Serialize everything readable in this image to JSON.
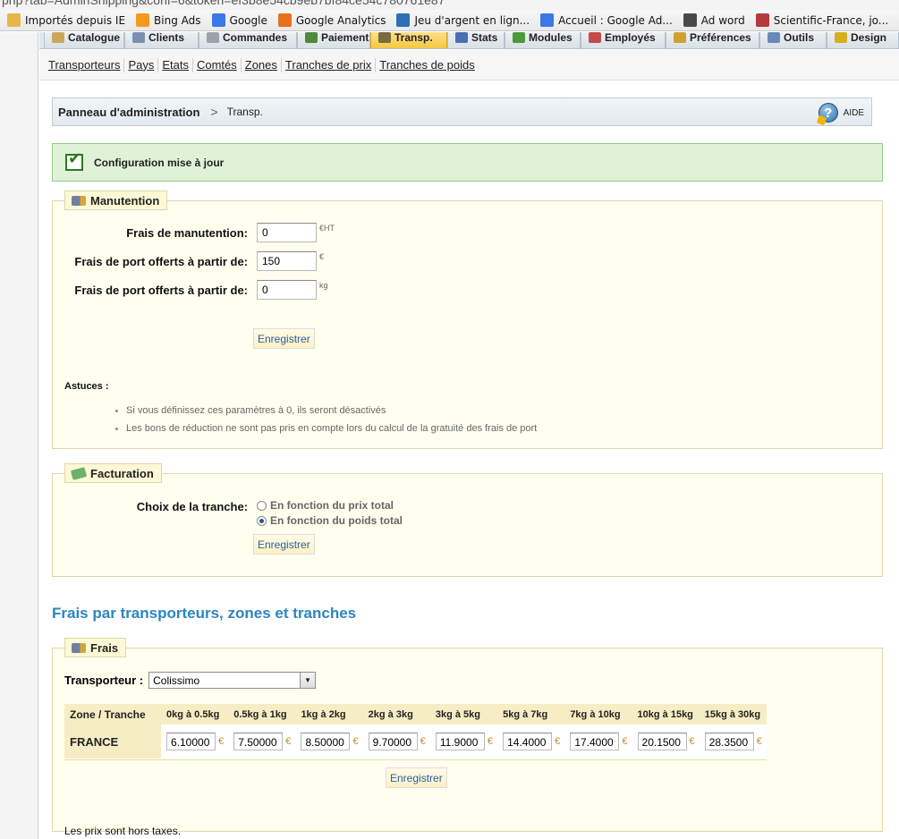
{
  "browser": {
    "url_fragment": "php?tab=AdminShipping&conf=6&token=ef3b8e54cb9eb7bf84ce54c780761e87",
    "bookmarks": [
      {
        "label": "Importés depuis IE",
        "icon": "folder-icon",
        "color": "#e8b54a"
      },
      {
        "label": "Bing Ads",
        "icon": "bing-icon",
        "color": "#f39a1e"
      },
      {
        "label": "Google",
        "icon": "google-icon",
        "color": "#3b78e7"
      },
      {
        "label": "Google Analytics",
        "icon": "analytics-icon",
        "color": "#e8711c"
      },
      {
        "label": "Jeu d'argent en lign...",
        "icon": "diamond-icon",
        "color": "#2c6fb5"
      },
      {
        "label": "Accueil : Google Ad...",
        "icon": "google-icon",
        "color": "#3b78e7"
      },
      {
        "label": "Ad word",
        "icon": "google-g-icon",
        "color": "#4a4a4a"
      },
      {
        "label": "Scientific-France, jo...",
        "icon": "gear-icon",
        "color": "#b33b3b"
      }
    ]
  },
  "main_tabs": [
    {
      "label": "Catalogue",
      "color": "#caa85a"
    },
    {
      "label": "Clients",
      "color": "#7b8fb0"
    },
    {
      "label": "Commandes",
      "color": "#9aa3ab"
    },
    {
      "label": "Paiement",
      "color": "#4f8a3a"
    },
    {
      "label": "Transp.",
      "color": "#7a6a40",
      "active": true
    },
    {
      "label": "Stats",
      "color": "#4a6fb5"
    },
    {
      "label": "Modules",
      "color": "#4b9a3a"
    },
    {
      "label": "Employés",
      "color": "#c24a4a"
    },
    {
      "label": "Préférences",
      "color": "#d2a030"
    },
    {
      "label": "Outils",
      "color": "#6a8ab5"
    },
    {
      "label": "Design",
      "color": "#d4b020"
    }
  ],
  "sub_tabs": [
    "Transporteurs",
    "Pays",
    "Etats",
    "Comtés",
    "Zones",
    "Tranches de prix",
    "Tranches de poids"
  ],
  "breadcrumb": {
    "home": "Panneau d'administration",
    "separator": ">",
    "current": "Transp.",
    "help_label": "AIDE",
    "help_icon_text": "?"
  },
  "confirmation": "Configuration mise à jour",
  "handling": {
    "legend": "Manutention",
    "fields": [
      {
        "label": "Frais de manutention:",
        "value": "0",
        "unit": "€HT"
      },
      {
        "label": "Frais de port offerts à partir de:",
        "value": "150",
        "unit": "€"
      },
      {
        "label": "Frais de port offerts à partir de:",
        "value": "0",
        "unit": "kg"
      }
    ],
    "save_label": "Enregistrer",
    "tips_title": "Astuces :",
    "tips": [
      "Si vous définissez ces paramètres à 0, ils seront désactivés",
      "Les bons de réduction ne sont pas pris en compte lors du calcul de la gratuité des frais de port"
    ]
  },
  "billing": {
    "legend": "Facturation",
    "label": "Choix de la tranche:",
    "options": [
      {
        "label": "En fonction du prix total",
        "checked": false
      },
      {
        "label": "En fonction du poids total",
        "checked": true
      }
    ],
    "save_label": "Enregistrer"
  },
  "fees_title": "Frais par transporteurs, zones et tranches",
  "fees": {
    "legend": "Frais",
    "carrier_label": "Transporteur :",
    "carrier_value": "Colissimo",
    "columns": [
      "Zone / Tranche",
      "0kg à 0.5kg",
      "0.5kg à 1kg",
      "1kg à 2kg",
      "2kg à 3kg",
      "3kg à 5kg",
      "5kg à 7kg",
      "7kg à 10kg",
      "10kg à 15kg",
      "15kg à 30kg"
    ],
    "rows": [
      {
        "zone": "FRANCE",
        "values": [
          "6.10000",
          "7.50000",
          "8.50000",
          "9.70000",
          "11.9000",
          "14.4000",
          "17.4000",
          "20.1500",
          "28.3500"
        ]
      }
    ],
    "currency": "€",
    "save_label": "Enregistrer",
    "note": "Les prix sont hors taxes."
  }
}
